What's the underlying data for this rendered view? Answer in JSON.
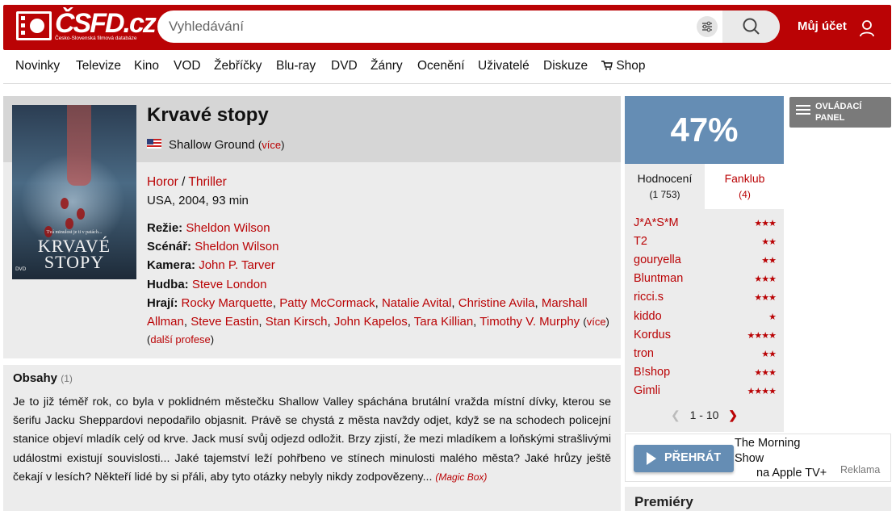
{
  "header": {
    "logo_text": "ČSFD.cz",
    "logo_subtitle": "Česko-Slovenská filmová databáze",
    "search_placeholder": "Vyhledávání",
    "account_label": "Můj účet"
  },
  "nav": {
    "items": [
      "Novinky",
      "Televize",
      "Kino",
      "VOD",
      "Žebříčky",
      "Blu-ray",
      "DVD",
      "Žánry",
      "Ocenění",
      "Uživatelé",
      "Diskuze",
      "Shop"
    ]
  },
  "film": {
    "title": "Krvavé stopy",
    "alt_title": "Shallow Ground",
    "alt_more": "více",
    "genres": [
      "Horor",
      "Thriller"
    ],
    "genre_sep": " / ",
    "origin": "USA, 2004, 93 min",
    "poster": {
      "tagline": "Tvá minulost je ti v patách...",
      "title_line1": "KRVAVÉ",
      "title_line2": "STOPY",
      "dvd": "DVD"
    },
    "creators": {
      "directing_label": "Režie:",
      "directing": "Sheldon Wilson",
      "writing_label": "Scénář:",
      "writing": "Sheldon Wilson",
      "camera_label": "Kamera:",
      "camera": "John P. Tarver",
      "music_label": "Hudba:",
      "music": "Steve London",
      "cast_label": "Hrají:",
      "cast": [
        "Rocky Marquette",
        "Patty McCormack",
        "Natalie Avital",
        "Christine Avila",
        "Marshall Allman",
        "Steve Eastin",
        "Stan Kirsch",
        "John Kapelos",
        "Tara Killian",
        "Timothy V. Murphy"
      ],
      "cast_more": "více"
    },
    "other_professions": "další profese"
  },
  "plot": {
    "title": "Obsahy",
    "count": "(1)",
    "text": "Je to již téměř rok, co byla v poklidném městečku Shallow Valley spáchána brutální vražda místní dívky, kterou se šerifu Jacku Sheppardovi nepodařilo objasnit. Právě se chystá z města navždy odjet, když se na schodech policejní stanice objeví mladík celý od krve. Jack musí svůj odjezd odložit. Brzy zjistí, že mezi mladíkem a loňskými strašlivými událostmi existují souvislosti... Jaké tajemství leží pohřbeno ve stínech minulosti malého města? Jaké hrůzy ještě čekají v lesích? Někteří lidé by si přáli, aby tyto otázky nebyly nikdy zodpovězeny...",
    "source": "(Magic Box)"
  },
  "rating": {
    "value": "47%",
    "tab_ratings_label": "Hodnocení",
    "tab_ratings_count": "(1 753)",
    "tab_fanclub_label": "Fanklub",
    "tab_fanclub_count": "(4)",
    "users": [
      {
        "name": "J*A*S*M",
        "stars": 3
      },
      {
        "name": "T2",
        "stars": 2
      },
      {
        "name": "gouryella",
        "stars": 2
      },
      {
        "name": "Bluntman",
        "stars": 3
      },
      {
        "name": "ricci.s",
        "stars": 3
      },
      {
        "name": "kiddo",
        "stars": 1
      },
      {
        "name": "Kordus",
        "stars": 4
      },
      {
        "name": "tron",
        "stars": 2
      },
      {
        "name": "B!shop",
        "stars": 3
      },
      {
        "name": "Gimli",
        "stars": 4
      }
    ],
    "pager": "1 - 10"
  },
  "ad": {
    "button_label": "PŘEHRÁT",
    "line1": "The Morning",
    "line2": "Show",
    "line3": "na Apple TV+",
    "tag": "Reklama"
  },
  "premieres": {
    "title": "Premiéry"
  },
  "control_panel": {
    "label": "OVLÁDACÍ PANEL"
  }
}
